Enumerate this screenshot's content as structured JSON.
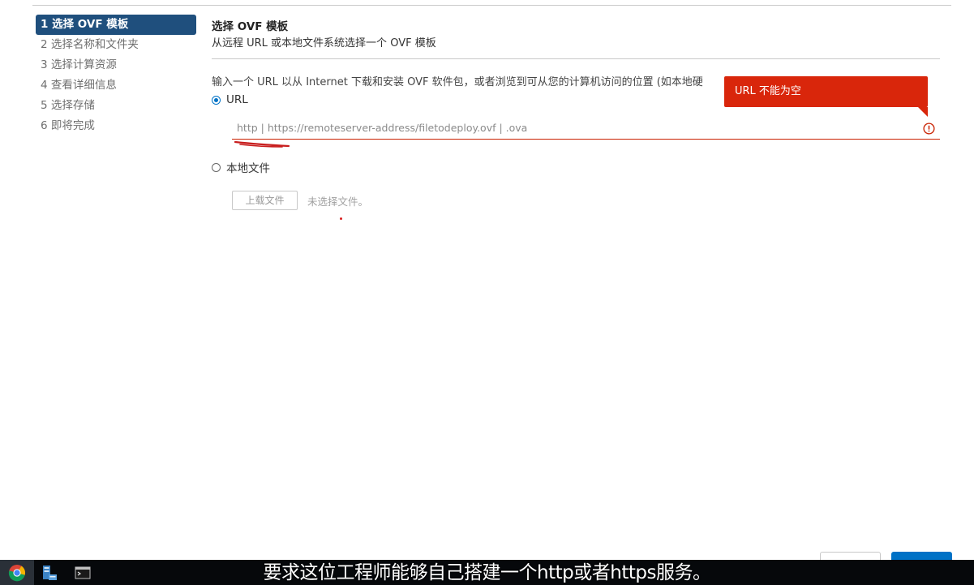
{
  "wizard": {
    "steps": [
      {
        "label": "1 选择 OVF 模板",
        "active": true
      },
      {
        "label": "2 选择名称和文件夹",
        "active": false
      },
      {
        "label": "3 选择计算资源",
        "active": false
      },
      {
        "label": "4 查看详细信息",
        "active": false
      },
      {
        "label": "5 选择存储",
        "active": false
      },
      {
        "label": "6 即将完成",
        "active": false
      }
    ]
  },
  "main": {
    "title": "选择 OVF 模板",
    "subtitle": "从远程 URL 或本地文件系统选择一个 OVF 模板",
    "description": "输入一个 URL 以从 Internet 下载和安装 OVF 软件包，或者浏览到可从您的计算机访问的位置 (如本地硬",
    "url_option": {
      "label": "URL",
      "checked": true,
      "value": "",
      "placeholder": "http | https://remoteserver-address/filetodeploy.ovf | .ova",
      "error_tooltip": "URL 不能为空"
    },
    "local_option": {
      "label": "本地文件",
      "checked": false,
      "upload_button": "上载文件",
      "no_file_text": "未选择文件。"
    }
  },
  "caption": "要求这位工程师能够自己搭建一个http或者https服务。",
  "colors": {
    "active_step": "#1f4f7d",
    "error": "#d9260b",
    "primary": "#0072c6"
  },
  "taskbar": {
    "icons": [
      "chrome-icon",
      "server-manager-icon",
      "command-prompt-icon"
    ]
  }
}
